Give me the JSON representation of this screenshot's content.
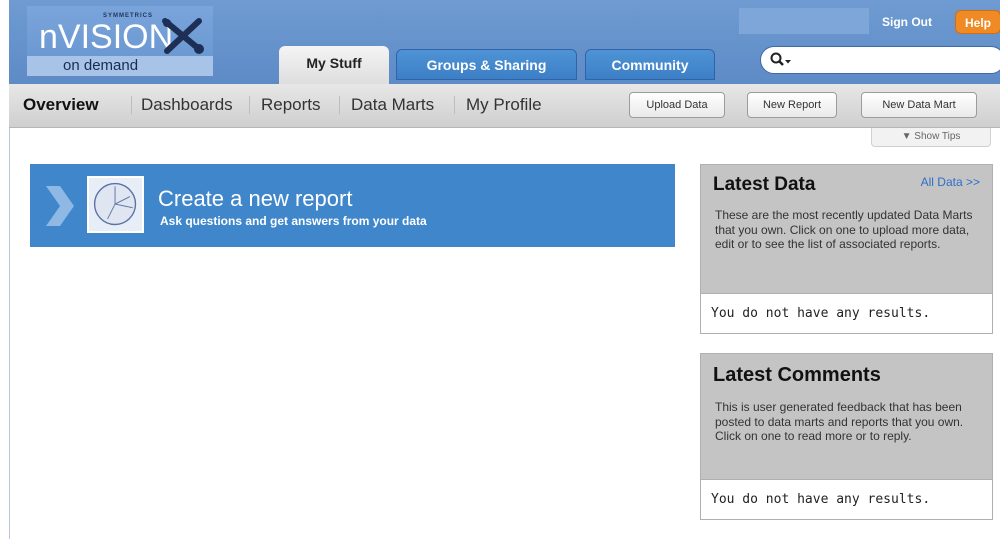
{
  "brand": {
    "company": "SYMMETRICS",
    "product": "nVISION",
    "tagline": "on demand"
  },
  "header": {
    "sign_out": "Sign Out",
    "help": "Help",
    "tabs": [
      {
        "label": "My Stuff",
        "active": true
      },
      {
        "label": "Groups & Sharing",
        "active": false
      },
      {
        "label": "Community",
        "active": false
      }
    ],
    "search": {
      "placeholder": "",
      "value": ""
    }
  },
  "subnav": {
    "items": [
      {
        "label": "Overview",
        "active": true
      },
      {
        "label": "Dashboards",
        "active": false
      },
      {
        "label": "Reports",
        "active": false
      },
      {
        "label": "Data Marts",
        "active": false
      },
      {
        "label": "My Profile",
        "active": false
      }
    ],
    "buttons": {
      "upload": "Upload Data",
      "new_report": "New Report",
      "new_data_mart": "New Data Mart"
    },
    "show_tips": "▼ Show Tips"
  },
  "main": {
    "banner": {
      "title": "Create a new report",
      "subtitle": "Ask questions and get answers from your data"
    }
  },
  "sidebar": {
    "latest_data": {
      "title": "Latest Data",
      "link": "All Data >>",
      "description": "These are the most recently updated Data Marts that you own. Click on one to upload more data, edit or to see the list of associated reports.",
      "empty": "You do not have any results."
    },
    "latest_comments": {
      "title": "Latest Comments",
      "description": "This is user generated feedback that has been posted to data marts and reports that you own. Click on one to read more or to reply.",
      "empty": "You do not have any results."
    }
  },
  "colors": {
    "header": "#6f9bd2",
    "tab_blue": "#3f86cb",
    "help_orange": "#f08a24",
    "panel_gray": "#c4c4c4",
    "link_blue": "#2d6fc8"
  }
}
